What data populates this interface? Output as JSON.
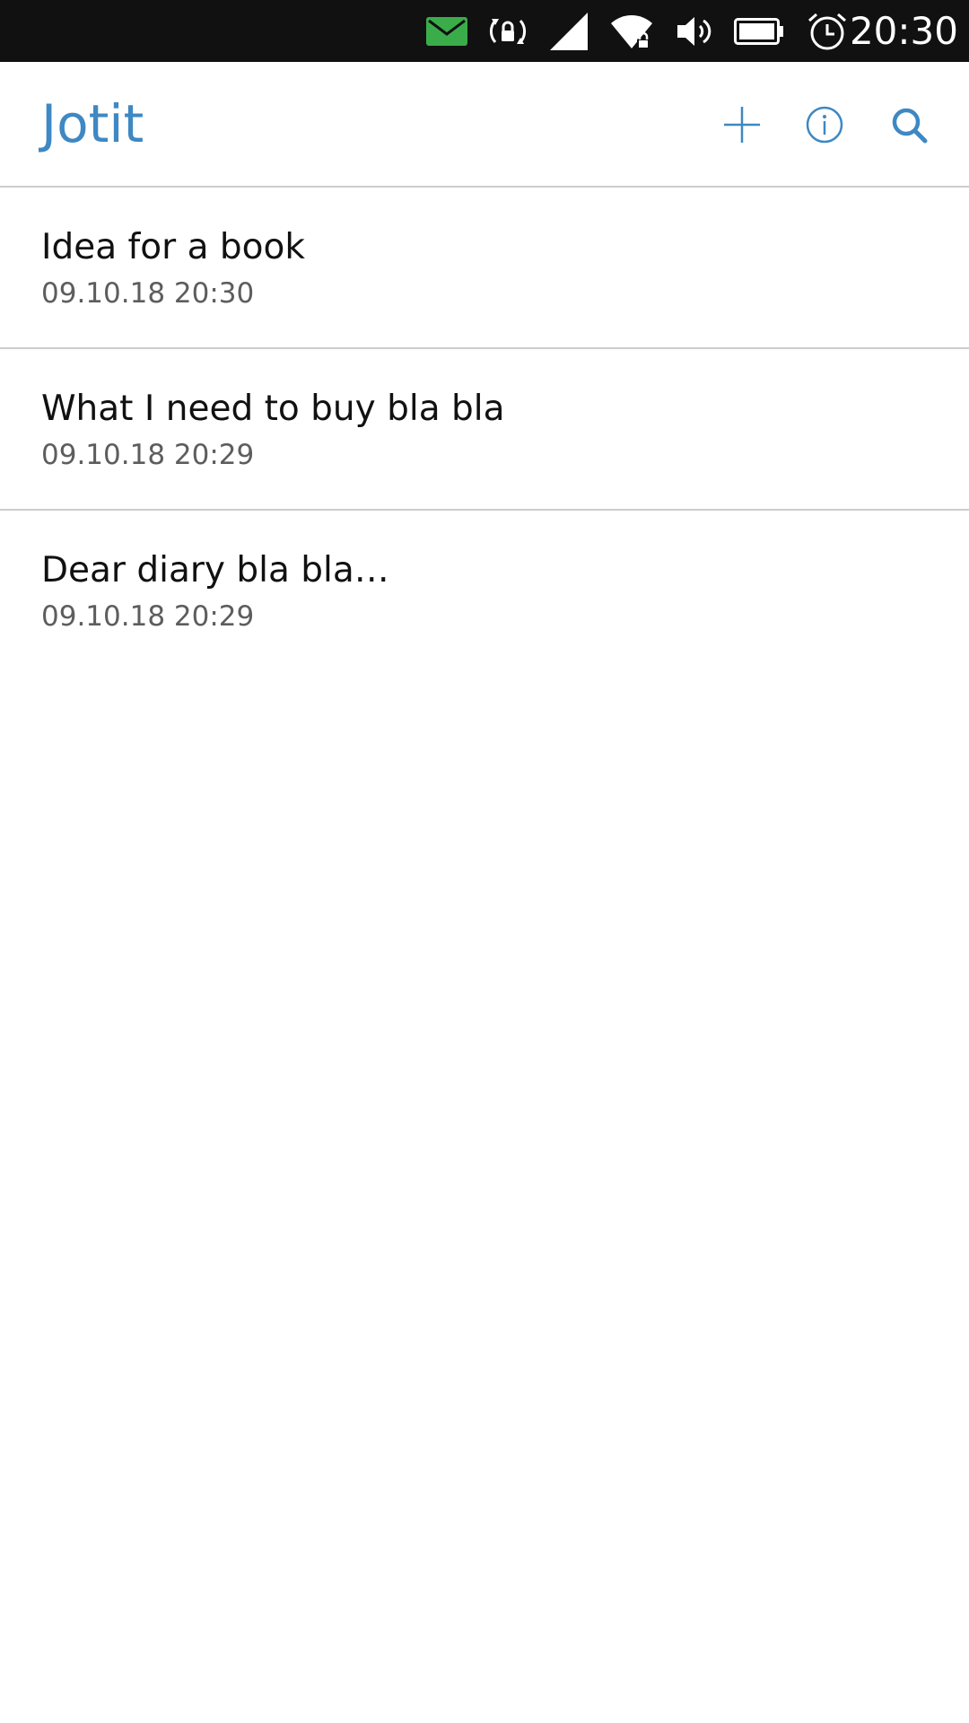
{
  "status_bar": {
    "time": "20:30",
    "icons": [
      "mail-icon",
      "rotation-lock-icon",
      "cellular-signal-icon",
      "wifi-icon",
      "volume-icon",
      "battery-icon",
      "alarm-icon"
    ],
    "mail_color": "#3aad4a"
  },
  "header": {
    "title": "Jotit",
    "title_color": "#3e88c3",
    "actions": [
      "add-icon",
      "info-icon",
      "search-icon"
    ]
  },
  "notes": [
    {
      "title": "Idea for a book",
      "date": "09.10.18 20:30"
    },
    {
      "title": "What I need to buy bla bla",
      "date": "09.10.18 20:29"
    },
    {
      "title": "Dear diary bla bla…",
      "date": "09.10.18 20:29"
    }
  ]
}
